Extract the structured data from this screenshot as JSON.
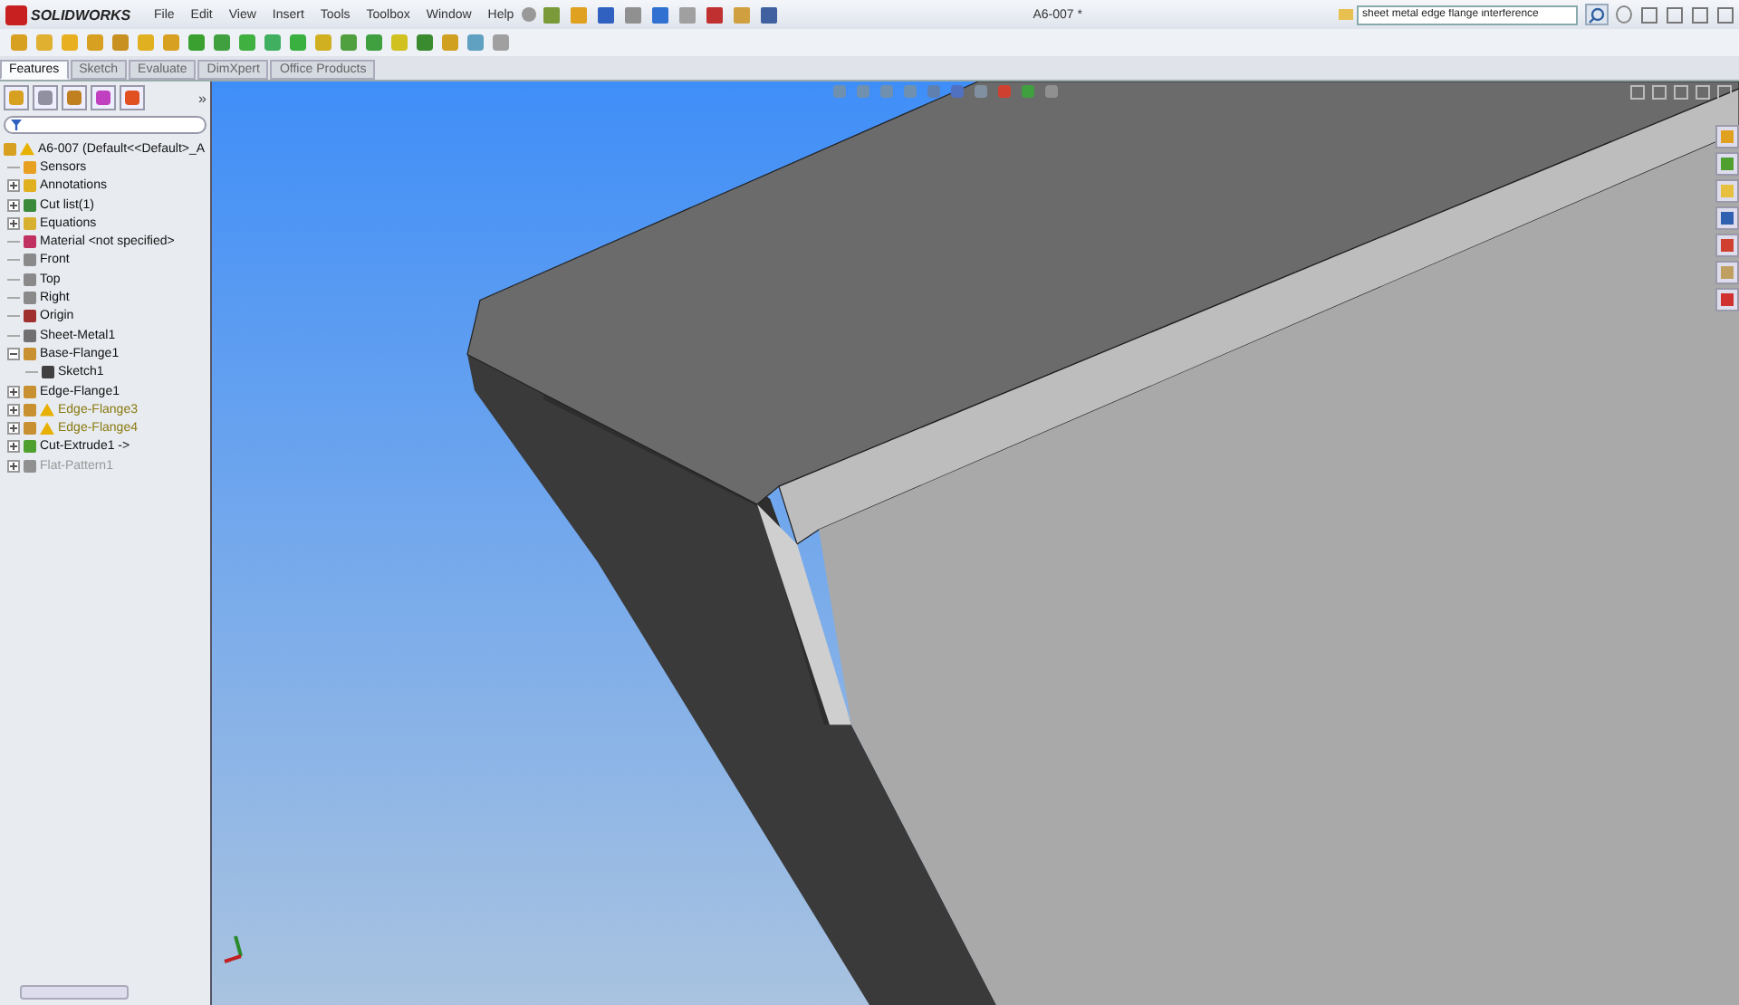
{
  "app": {
    "brand": "SOLIDWORKS"
  },
  "menu": [
    "File",
    "Edit",
    "View",
    "Insert",
    "Tools",
    "Toolbox",
    "Window",
    "Help"
  ],
  "document_title": "A6-007 *",
  "search": {
    "value": "sheet metal edge flange interference"
  },
  "command_tabs": [
    {
      "label": "Features",
      "selected": true
    },
    {
      "label": "Sketch",
      "selected": false
    },
    {
      "label": "Evaluate",
      "selected": false
    },
    {
      "label": "DimXpert",
      "selected": false
    },
    {
      "label": "Office Products",
      "selected": false
    }
  ],
  "panel_collapse": "»",
  "feature_tree": {
    "root": {
      "label": "A6-007  (Default<<Default>_A",
      "warning": true,
      "children": [
        {
          "label": "Sensors",
          "kind": "sensor"
        },
        {
          "label": "Annotations",
          "kind": "annotation",
          "expanded": false
        },
        {
          "label": "Cut list(1)",
          "kind": "cutlist",
          "expanded": false
        },
        {
          "label": "Equations",
          "kind": "equation",
          "expanded": false
        },
        {
          "label": "Material <not specified>",
          "kind": "material"
        },
        {
          "label": "Front",
          "kind": "plane"
        },
        {
          "label": "Top",
          "kind": "plane"
        },
        {
          "label": "Right",
          "kind": "plane"
        },
        {
          "label": "Origin",
          "kind": "origin"
        },
        {
          "label": "Sheet-Metal1",
          "kind": "sheetmetal"
        },
        {
          "label": "Base-Flange1",
          "kind": "flange",
          "expanded": true,
          "children": [
            {
              "label": "Sketch1",
              "kind": "sketch"
            }
          ]
        },
        {
          "label": "Edge-Flange1",
          "kind": "flange",
          "expanded": false
        },
        {
          "label": "Edge-Flange3",
          "kind": "flange",
          "expanded": false,
          "warning": true
        },
        {
          "label": "Edge-Flange4",
          "kind": "flange",
          "expanded": false,
          "warning": true
        },
        {
          "label": "Cut-Extrude1 ->",
          "kind": "cut",
          "expanded": false
        },
        {
          "label": "Flat-Pattern1",
          "kind": "flat",
          "expanded": false,
          "suppressed": true
        }
      ]
    }
  }
}
